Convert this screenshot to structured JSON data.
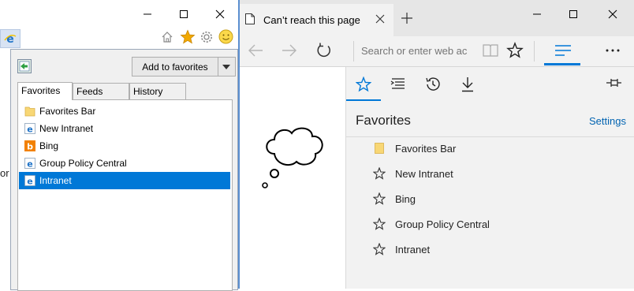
{
  "ie_window": {
    "title_buttons": [
      "minimize",
      "maximize",
      "close"
    ],
    "truncated_text": "or",
    "favorites_center": {
      "add_to_favorites_label": "Add to favorites",
      "tabs": [
        {
          "label": "Favorites",
          "active": true
        },
        {
          "label": "Feeds",
          "active": false
        },
        {
          "label": "History",
          "active": false
        }
      ],
      "items": [
        {
          "label": "Favorites Bar",
          "icon": "folder-icon",
          "selected": false
        },
        {
          "label": "New Intranet",
          "icon": "ie-page-icon",
          "selected": false
        },
        {
          "label": "Bing",
          "icon": "bing-icon",
          "selected": false
        },
        {
          "label": "Group Policy Central",
          "icon": "ie-page-icon",
          "selected": false
        },
        {
          "label": "Intranet",
          "icon": "ie-page-icon",
          "selected": true
        }
      ]
    }
  },
  "edge_window": {
    "tab_title": "Can’t reach this page",
    "address_placeholder": "Search or enter web ac",
    "hub": {
      "title": "Favorites",
      "settings_label": "Settings",
      "items": [
        {
          "label": "Favorites Bar",
          "icon": "folder-icon"
        },
        {
          "label": "New Intranet",
          "icon": "star-outline-icon"
        },
        {
          "label": "Bing",
          "icon": "star-outline-icon"
        },
        {
          "label": "Group Policy Central",
          "icon": "star-outline-icon"
        },
        {
          "label": "Intranet",
          "icon": "star-outline-icon"
        }
      ]
    }
  },
  "colors": {
    "accent": "#0078d7",
    "folder": "#f8d775",
    "gold_star": "#f2a900",
    "ie_blue": "#1e73c8",
    "bing_orange": "#f28100"
  }
}
